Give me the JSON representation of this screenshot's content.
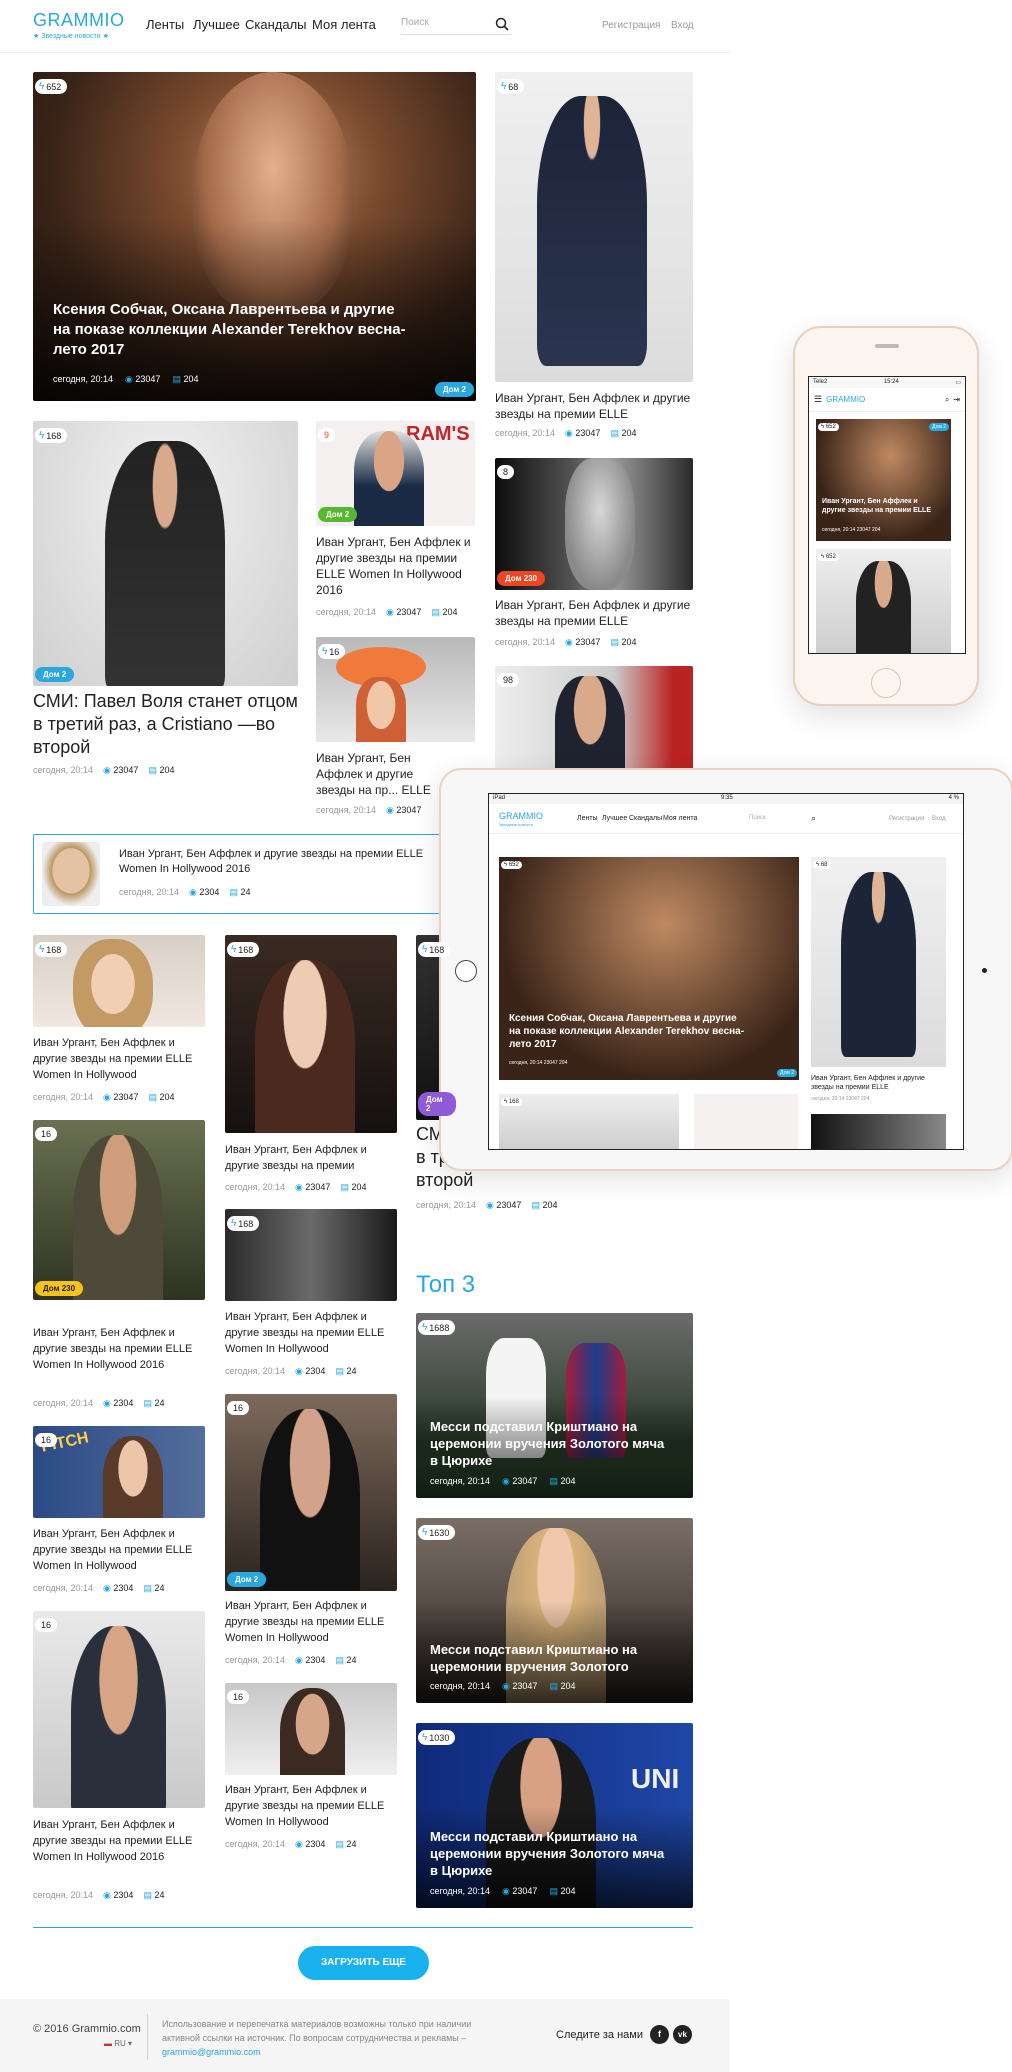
{
  "header": {
    "logo": "GRAMMIO",
    "logo_sub": "Звездные новости",
    "nav": [
      "Ленты",
      "Лучшее",
      "Скандалы",
      "Моя лента"
    ],
    "search_placeholder": "Поиск",
    "register": "Регистрация",
    "login": "Вход"
  },
  "posts": {
    "hero": {
      "count": "652",
      "title": "Ксения Собчак, Оксана Лаврентьева и другие на показе коллекции Alexander Terekhov весна-лето 2017",
      "time": "сегодня, 20:14",
      "views": "23047",
      "comments": "204",
      "tag": "Дом 2"
    },
    "urgant_a": {
      "count": "68",
      "title": "Иван Ургант, Бен Аффлек и другие звезды на премии ELLE",
      "time": "сегодня, 20:14",
      "views": "23047",
      "comments": "204"
    },
    "volya": {
      "count": "168",
      "tag": "Дом 2",
      "title": "СМИ: Павел Воля станет отцом в третий раз, а Cristiano —во второй",
      "time": "сегодня, 20:14",
      "views": "23047",
      "comments": "204"
    },
    "ivan": {
      "count": "9",
      "tag": "Дом 2",
      "title": "Иван Ургант, Бен Аффлек и другие звезды на премии ELLE Women In Hollywood 2016",
      "time": "сегодня, 20:14",
      "views": "23047",
      "comments": "204"
    },
    "bw": {
      "count": "8",
      "tag": "Дом 230",
      "title": "Иван Ургант, Бен Аффлек и другие звезды на премии ELLE",
      "time": "сегодня, 20:14",
      "views": "23047",
      "comments": "204"
    },
    "redhead": {
      "count": "16",
      "title": "Иван Ургант, Бен Аффлек и другие звезды на пр... ELLE Women In Hollywoo...",
      "time": "сегодня, 20:14",
      "views": "23047"
    },
    "ryan": {
      "count": "98"
    },
    "inline": {
      "title": "Иван Ургант, Бен Аффлек и другие звезды на премии ELLE Women In Hollywood 2016",
      "time": "сегодня, 20:14",
      "views": "2304",
      "comments": "24"
    },
    "g1": {
      "count": "168",
      "title": "Иван Ургант, Бен Аффлек и другие звезды на премии ELLE Women In Hollywood",
      "time": "сегодня, 20:14",
      "views": "23047",
      "comments": "204"
    },
    "g2": {
      "count": "168",
      "title": "Иван Ургант, Бен Аффлек и другие звезды на премии",
      "time": "сегодня, 20:14",
      "views": "23047",
      "comments": "204"
    },
    "g3": {
      "count": "168",
      "tag": "Дом 2",
      "title": "СМИ: Павел Воля станет отцом в третий раз, а Cristiano —во второй",
      "time": "сегодня, 20:14",
      "views": "23047",
      "comments": "204"
    },
    "g4": {
      "count": "16",
      "tag": "Дом 230",
      "title": "Иван Ургант, Бен Аффлек и другие звезды на премии ELLE Women In Hollywood 2016",
      "time": "сегодня, 20:14",
      "views": "2304",
      "comments": "24"
    },
    "g5": {
      "count": "168",
      "title": "Иван Ургант, Бен Аффлек и другие звезды на премии ELLE Women In Hollywood",
      "time": "сегодня, 20:14",
      "views": "2304",
      "comments": "24"
    },
    "g6": {
      "count": "16",
      "title": "Иван Ургант, Бен Аффлек и другие звезды на премии ELLE Women In Hollywood",
      "time": "сегодня, 20:14",
      "views": "2304",
      "comments": "24"
    },
    "g7": {
      "count": "16",
      "tag": "Дом 2",
      "title": "Иван Ургант, Бен Аффлек и другие звезды на премии ELLE Women In Hollywood",
      "time": "сегодня, 20:14",
      "views": "2304",
      "comments": "24"
    },
    "g8": {
      "count": "16",
      "title": "Иван Ургант, Бен Аффлек и другие звезды на премии ELLE Women In Hollywood 2016",
      "time": "сегодня, 20:14",
      "views": "2304",
      "comments": "24"
    },
    "g9": {
      "count": "16",
      "title": "Иван Ургант, Бен Аффлек и другие звезды на премии ELLE Women In Hollywood",
      "time": "сегодня, 20:14",
      "views": "2304",
      "comments": "24"
    }
  },
  "top3": {
    "heading": "Топ 3",
    "items": [
      {
        "count": "1688",
        "title": "Месси подставил Криштиано на церемонии вручения Золотого мяча в Цюрихе",
        "time": "сегодня, 20:14",
        "views": "23047",
        "comments": "204"
      },
      {
        "count": "1630",
        "title": "Месси подставил Криштиано на церемонии вручения Золотого",
        "time": "сегодня, 20:14",
        "views": "23047",
        "comments": "204"
      },
      {
        "count": "1030",
        "title": "Месси подставил Криштиано на церемонии вручения Золотого мяча в Цюрихе",
        "time": "сегодня, 20:14",
        "views": "23047",
        "comments": "204"
      }
    ]
  },
  "load_more": "ЗАГРУЗИТЬ ЕЩЕ",
  "footer": {
    "copyright": "© 2016 Grammio.com",
    "lang": "RU",
    "legal": "Использование и перепечатка материалов возможны только при наличии активной ссылки на источник. По вопросам сотрудничества и рекламы –",
    "email": "grammio@grammio.com",
    "follow": "Следите за нами",
    "social": [
      "f",
      "vk"
    ]
  },
  "phone": {
    "carrier": "Tele2",
    "time": "15:24",
    "logo": "GRAMMIO",
    "c1": "652",
    "c2": "652",
    "tag": "Дом 2",
    "title": "Иван Ургант, Бен Аффлек и другие звезды на премии ELLE",
    "meta": "сегодня, 20:14  23047  204"
  },
  "tablet": {
    "device": "iPad",
    "time": "9:35",
    "battery": "4 % ",
    "c1": "652",
    "c2": "68",
    "c3": "168",
    "title": "Ксения Собчак, Оксана Лаврентьева и другие на показе коллекции Alexander Terekhov весна-лето 2017",
    "meta": "сегодня, 20:14  23047  204",
    "tag": "Дом 2",
    "side": "Иван Ургант, Бен Аффлек и другие звезды на премии ELLE",
    "side_meta": "сегодня, 20:14  23047  204"
  }
}
